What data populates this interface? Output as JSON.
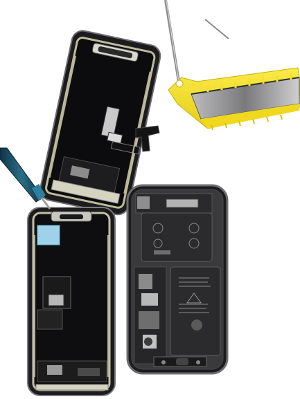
{
  "scene": {
    "background": "#ffffff",
    "battery_labels": {
      "upper_cell_brand": "",
      "lower_cell_text": ""
    }
  },
  "colors": {
    "frame_dark": "#1c1c1e",
    "frame_steel": "#6e6e70",
    "board_black": "#101012",
    "battery_grey": "#2b2b2e",
    "pry_yellow": "#f3df2a",
    "metal_silver": "#9a9a9c",
    "driver_teal": "#1b4b5e",
    "sticker_blue": "#9fd2e8"
  }
}
